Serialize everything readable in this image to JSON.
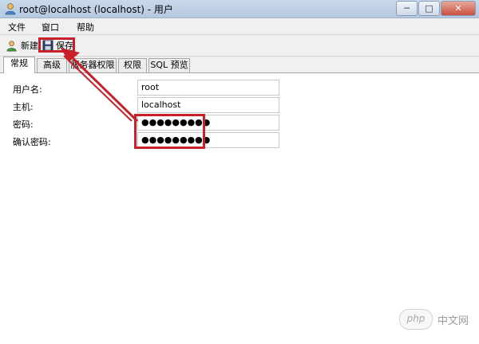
{
  "window": {
    "title": "root@localhost (localhost) - 用户",
    "minimize": "─",
    "maximize": "□",
    "close": "✕"
  },
  "menu": {
    "items": [
      "文件",
      "窗口",
      "帮助"
    ]
  },
  "toolbar": {
    "new_label": "新建",
    "save_label": "保存"
  },
  "tabs": [
    {
      "label": "常规",
      "active": true
    },
    {
      "label": "高级",
      "active": false
    },
    {
      "label": "服务器权限",
      "active": false
    },
    {
      "label": "权限",
      "active": false
    },
    {
      "label": "SQL 预览",
      "active": false
    }
  ],
  "form": {
    "username": {
      "label": "用户名:",
      "value": "root"
    },
    "host": {
      "label": "主机:",
      "value": "localhost"
    },
    "password": {
      "label": "密码:",
      "value": "●●●●●●●●●"
    },
    "confirm_password": {
      "label": "确认密码:",
      "value": "●●●●●●●●●"
    }
  },
  "annotation": {
    "color": "#c8202b"
  },
  "watermark": {
    "logo": "php",
    "text": "中文网"
  }
}
